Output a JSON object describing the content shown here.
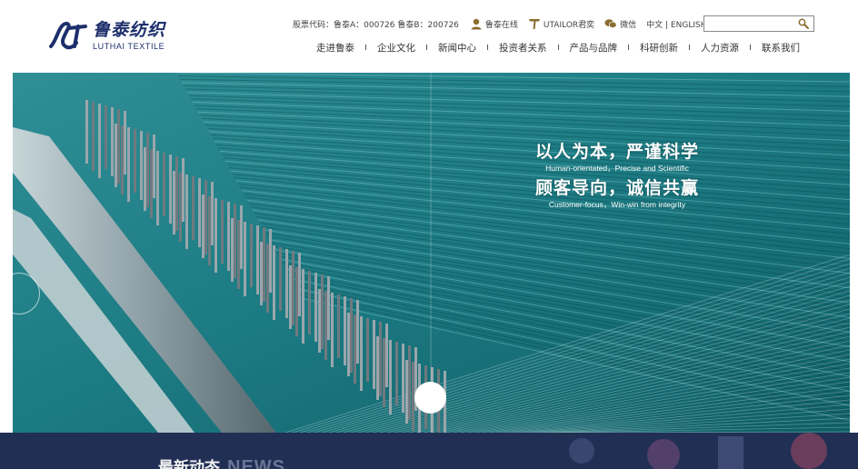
{
  "brand": {
    "name_cn": "鲁泰纺织",
    "name_en": "LUTHAI TEXTILE",
    "color": "#1d2f6b"
  },
  "topbar": {
    "stock": "股票代码：鲁泰A：000726 鲁泰B：200726",
    "links": [
      {
        "label": "鲁泰在线",
        "icon": "person-icon"
      },
      {
        "label": "UTAILOR君奕",
        "icon": "t-logo-icon"
      },
      {
        "label": "微信",
        "icon": "wechat-icon"
      }
    ],
    "language": "中文 | ENGLISH"
  },
  "search": {
    "placeholder": "",
    "icon": "search-icon"
  },
  "nav": {
    "items": [
      "走进鲁泰",
      "企业文化",
      "新闻中心",
      "投资者关系",
      "产品与品牌",
      "科研创新",
      "人力资源",
      "联系我们"
    ]
  },
  "hero": {
    "slogan_line1_cn": "以人为本，严谨科学",
    "slogan_line1_en": "Human-orientated，Precise and Scientific",
    "slogan_line2_cn": "顾客导向，诚信共赢",
    "slogan_line2_en": "Customer-focus，Win-win from integrity",
    "accent": "#1f7f86"
  },
  "news": {
    "title_cn": "最新动态",
    "title_en": "NEWS",
    "bg": "#222f55"
  }
}
